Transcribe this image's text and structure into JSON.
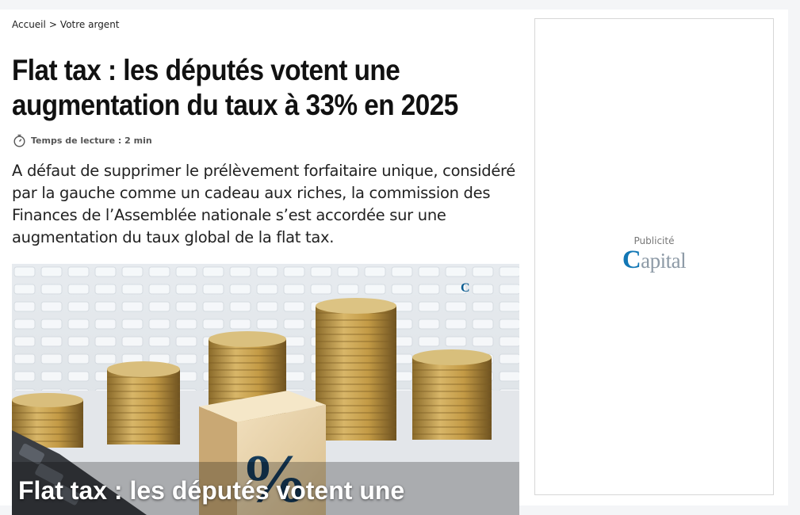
{
  "breadcrumb": {
    "home": "Accueil",
    "separator": ">",
    "section": "Votre argent"
  },
  "article": {
    "title": "Flat tax : les députés votent une augmentation du taux à 33% en 2025",
    "reading_time": "Temps de lecture : 2 min",
    "lead": "A défaut de supprimer le prélèvement forfaitaire unique, considéré par la gauche comme un cadeau aux riches, la commission des Finances de l’Assemblée nationale s’est accordée sur une augmentation du taux global de la flat tax.",
    "image": {
      "caption": "Flat tax : les députés votent une",
      "watermark": "Capital",
      "percent_symbol": "%"
    }
  },
  "ad": {
    "label": "Publicité",
    "logo_initial": "C",
    "logo_rest": "apital"
  },
  "icons": {
    "reading_time": "stopwatch-icon"
  },
  "colors": {
    "title": "#111111",
    "brand": "#1277b5",
    "brand_muted": "#8d9aa6",
    "page_bg": "#f4f5f7"
  }
}
